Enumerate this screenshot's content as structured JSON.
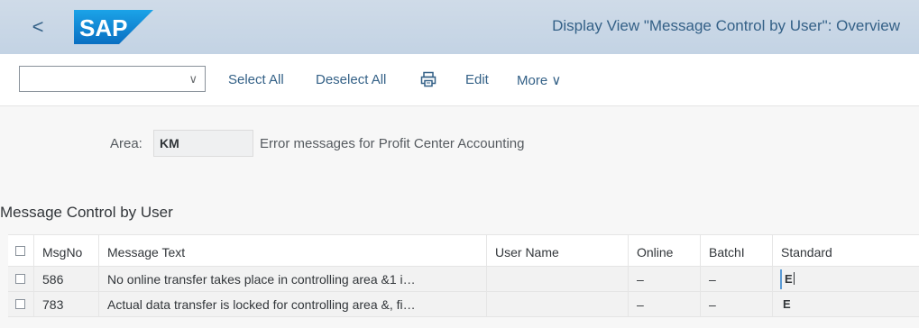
{
  "header": {
    "back_glyph": "<",
    "logo_text": "SAP",
    "title": "Display View \"Message Control by User\": Overview"
  },
  "toolbar": {
    "variant_value": "",
    "chevron_glyph": "∨",
    "select_all": "Select All",
    "deselect_all": "Deselect All",
    "edit": "Edit",
    "more": "More ∨"
  },
  "area": {
    "label": "Area:",
    "value": "KM",
    "description": "Error messages for Profit Center Accounting"
  },
  "section": {
    "title": "Message Control by User"
  },
  "table": {
    "columns": [
      "MsgNo",
      "Message Text",
      "User Name",
      "Online",
      "BatchI",
      "Standard"
    ],
    "rows": [
      {
        "msgno": "586",
        "text": "No online transfer takes place in controlling area &1 i…",
        "user": "",
        "online": "–",
        "batch": "–",
        "standard": "E"
      },
      {
        "msgno": "783",
        "text": "Actual data transfer is locked for controlling area &, fi…",
        "user": "",
        "online": "–",
        "batch": "–",
        "standard": "E"
      }
    ]
  },
  "colors": {
    "header_bg": "#c7d6e6",
    "accent": "#346187",
    "logo_blue": "#1a8cd8"
  }
}
